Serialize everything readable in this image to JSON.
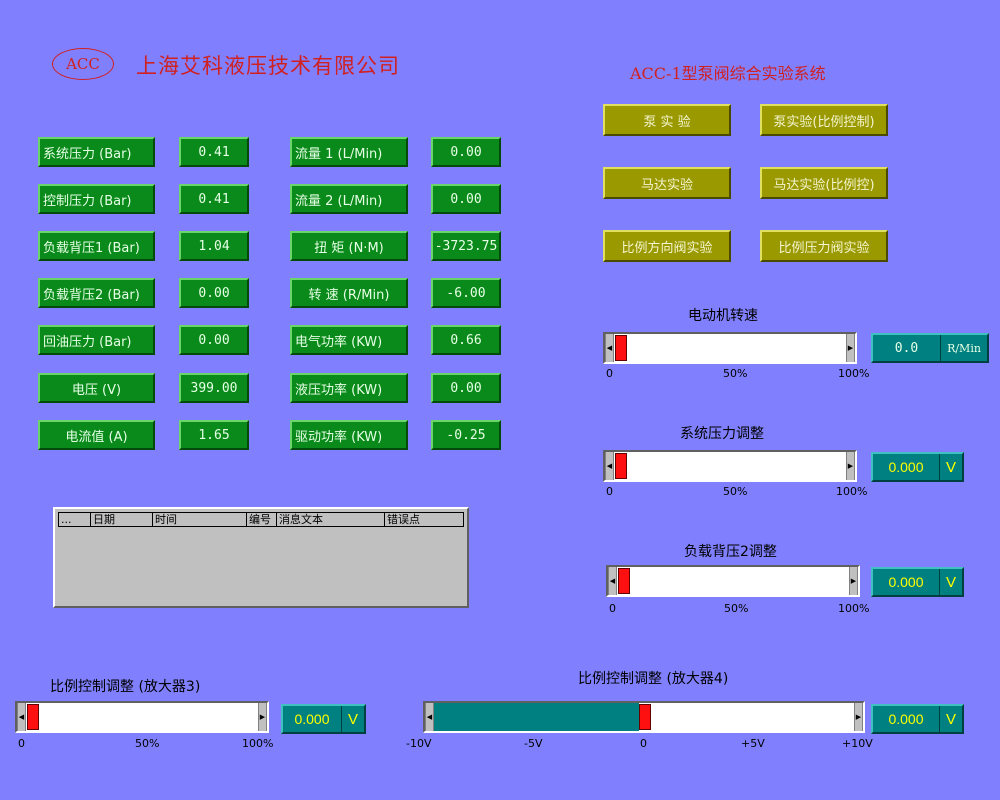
{
  "header": {
    "logo": "ACC",
    "company": "上海艾科液压技术有限公司",
    "system_title": "ACC-1型泵阀综合实验系统"
  },
  "readings_left": [
    {
      "label": "系统压力 (Bar)",
      "value": "0.41"
    },
    {
      "label": "控制压力 (Bar)",
      "value": "0.41"
    },
    {
      "label": "负载背压1 (Bar)",
      "value": "1.04"
    },
    {
      "label": "负载背压2 (Bar)",
      "value": "0.00"
    },
    {
      "label": "回油压力 (Bar)",
      "value": "0.00"
    },
    {
      "label": "电压 (V)",
      "value": "399.00"
    },
    {
      "label": "电流值 (A)",
      "value": "1.65"
    }
  ],
  "readings_right": [
    {
      "label": "流量 1 (L/Min)",
      "value": "0.00"
    },
    {
      "label": "流量 2 (L/Min)",
      "value": "0.00"
    },
    {
      "label": "扭 矩 (N·M)",
      "value": "-3723.75"
    },
    {
      "label": "转 速 (R/Min)",
      "value": "-6.00"
    },
    {
      "label": "电气功率 (KW)",
      "value": "0.66"
    },
    {
      "label": "液压功率 (KW)",
      "value": "0.00"
    },
    {
      "label": "驱动功率 (KW)",
      "value": "-0.25"
    }
  ],
  "buttons": [
    "泵 实 验",
    "泵实验(比例控制)",
    "马达实验",
    "马达实验(比例控)",
    "比例方向阀实验",
    "比例压力阀实验"
  ],
  "message_table": {
    "columns": [
      "...",
      "日期",
      "时间",
      "编号",
      "消息文本",
      "错误点"
    ]
  },
  "sliders": {
    "motor_speed": {
      "label": "电动机转速",
      "level": 0.0,
      "ticks": [
        "0",
        "50%",
        "100%"
      ],
      "value": "0.0",
      "unit": "R/Min"
    },
    "system_pressure": {
      "label": "系统压力调整",
      "level": 0.0,
      "ticks": [
        "0",
        "50%",
        "100%"
      ],
      "value": "0.000",
      "unit": "V"
    },
    "load_back_pressure2": {
      "label": "负载背压2调整",
      "level": 0.0,
      "ticks": [
        "0",
        "50%",
        "100%"
      ],
      "value": "0.000",
      "unit": "V"
    },
    "amp3": {
      "label": "比例控制调整 (放大器3)",
      "level": 0.0,
      "ticks": [
        "0",
        "50%",
        "100%"
      ],
      "value": "0.000",
      "unit": "V"
    },
    "amp4": {
      "label": "比例控制调整 (放大器4)",
      "level": 0.5,
      "ticks": [
        "-10V",
        "-5V",
        "0",
        "+5V",
        "+10V"
      ],
      "value": "0.000",
      "unit": "V"
    }
  },
  "colors": {
    "background": "#8080ff",
    "readout_green": "#0a8a1a",
    "button_olive": "#9a9a00",
    "display_teal": "#008080",
    "title_red": "#d02020",
    "thumb_red": "#ff1010"
  }
}
